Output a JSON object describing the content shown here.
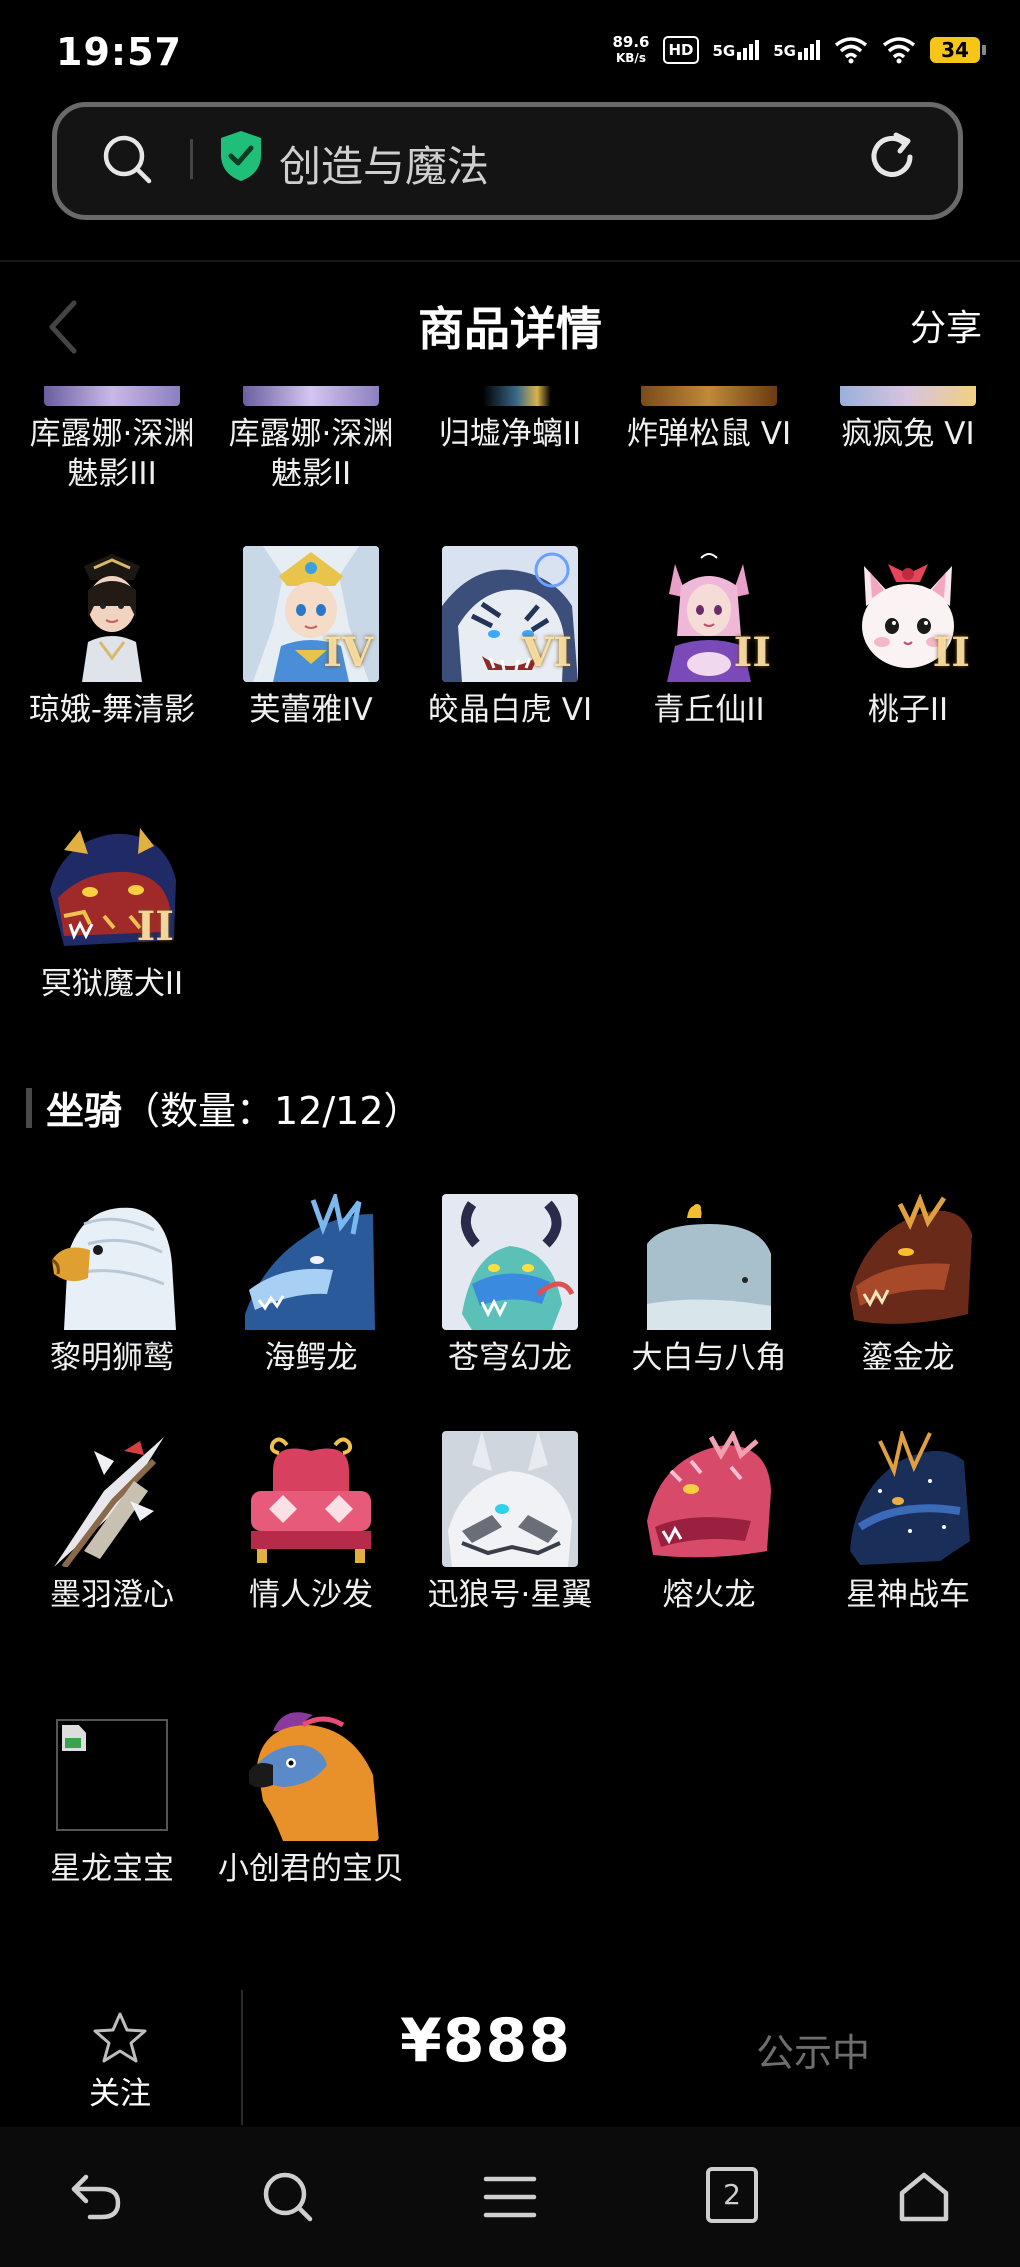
{
  "status_bar": {
    "time": "19:57",
    "net_speed_value": "89.6",
    "net_speed_unit": "KB/s",
    "hd_label": "HD",
    "sim1_label": "5G",
    "sim2_label": "5G",
    "battery": "34"
  },
  "browser": {
    "url_text": "创造与魔法"
  },
  "header": {
    "title": "商品详情",
    "share_label": "分享"
  },
  "top_partial_items": [
    {
      "label": "库露娜·深渊魅影III"
    },
    {
      "label": "库露娜·深渊魅影II"
    },
    {
      "label": "归墟净螭II"
    },
    {
      "label": "炸弹松鼠 VI"
    },
    {
      "label": "疯疯兔 VI"
    }
  ],
  "pets_rows": [
    {
      "label": "琼娥-舞清影",
      "icon": "chang-e-portrait"
    },
    {
      "label": "芙蕾雅IV",
      "icon": "freya-portrait",
      "badge": "IV"
    },
    {
      "label": "皎晶白虎 VI",
      "icon": "white-tiger-portrait",
      "badge": "VI"
    },
    {
      "label": "青丘仙II",
      "icon": "fox-fairy-portrait",
      "badge": "II"
    },
    {
      "label": "桃子II",
      "icon": "cat-portrait",
      "badge": "II"
    },
    {
      "label": "冥狱魔犬II",
      "icon": "hell-hound-portrait",
      "badge": "II"
    }
  ],
  "mounts_section": {
    "title": "坐骑",
    "count_text": "（数量：12/12）"
  },
  "mounts": [
    {
      "label": "黎明狮鹫",
      "icon": "griffin-portrait"
    },
    {
      "label": "海鳄龙",
      "icon": "sea-dragon-portrait"
    },
    {
      "label": "苍穹幻龙",
      "icon": "sky-dragon-portrait"
    },
    {
      "label": "大白与八角",
      "icon": "whale-portrait"
    },
    {
      "label": "鎏金龙",
      "icon": "gold-dragon-portrait"
    },
    {
      "label": "墨羽澄心",
      "icon": "feather-blade-portrait"
    },
    {
      "label": "情人沙发",
      "icon": "love-sofa-portrait"
    },
    {
      "label": "迅狼号·星翼",
      "icon": "mecha-wolf-portrait"
    },
    {
      "label": "熔火龙",
      "icon": "lava-dragon-portrait"
    },
    {
      "label": "星神战车",
      "icon": "star-chariot-portrait"
    },
    {
      "label": "星龙宝宝",
      "icon": "broken-image-icon"
    },
    {
      "label": "小创君的宝贝",
      "icon": "parrot-portrait"
    }
  ],
  "bottom_bar": {
    "follow_label": "关注",
    "price": "¥888",
    "status": "公示中"
  },
  "nav": {
    "tab_count": "2"
  },
  "colors": {
    "background": "#000000",
    "shield_green": "#1fbf7a",
    "battery": "#f5c518",
    "muted_text": "#6e6e6e"
  }
}
